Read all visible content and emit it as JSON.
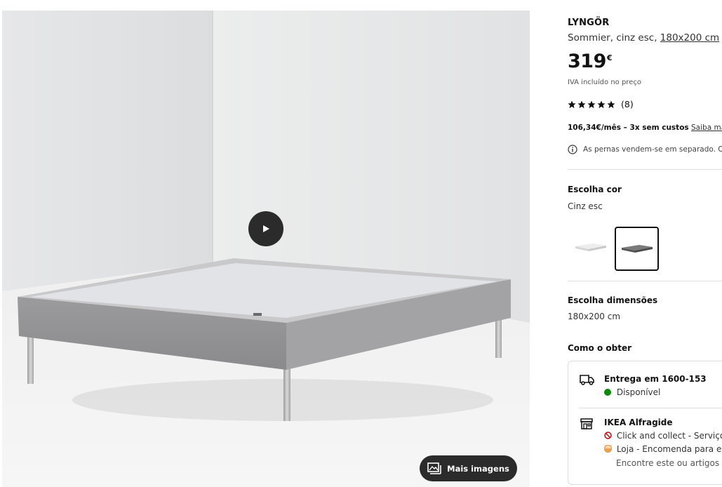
{
  "gallery": {
    "more_images_label": "Mais imagens",
    "play_icon": "play-icon",
    "images_icon": "images-icon"
  },
  "product": {
    "name": "LYNGÖR",
    "description": "Sommier, cinz esc, ",
    "size_link": "180x200 cm",
    "price": "319",
    "currency": "€",
    "vat_note": "IVA incluído no preço",
    "rating_count": "(8)",
    "installments_bold": "106,34€/mês – 3x sem custos",
    "installments_link": "Saiba mais",
    "legs_note": "As pernas vendem-se em separado. O c"
  },
  "color": {
    "title": "Escolha cor",
    "value": "Cinz esc",
    "options": [
      {
        "name": "light-grey",
        "color": "#d9d9d9",
        "selected": false
      },
      {
        "name": "dark-grey",
        "color": "#5f5f5f",
        "selected": true
      }
    ]
  },
  "dimensions": {
    "title": "Escolha dimensões",
    "value": "180x200 cm"
  },
  "availability": {
    "title": "Como o obter",
    "delivery": {
      "title": "Entrega em 1600-153",
      "status": "Disponível",
      "status_color": "#0a8a00"
    },
    "store": {
      "title": "IKEA Alfragide",
      "click_collect": "Click and collect - Serviço",
      "store_order": "Loja - Encomenda para en",
      "find_note": "Encontre este ou artigos s"
    }
  }
}
